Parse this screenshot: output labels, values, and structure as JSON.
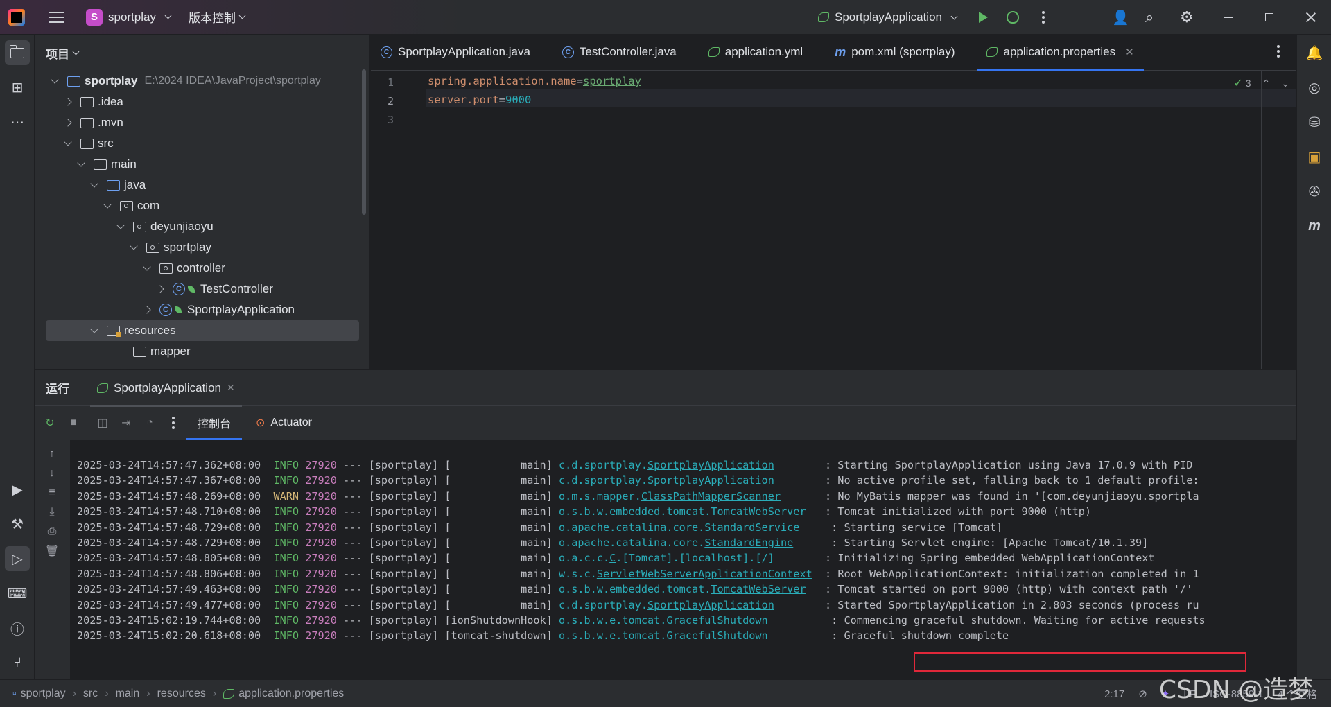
{
  "titlebar": {
    "project_badge": "S",
    "project_name": "sportplay",
    "vcs_label": "版本控制",
    "run_config": "SportplayApplication"
  },
  "project_panel": {
    "title": "项目",
    "tree": [
      {
        "label": "sportplay",
        "path": "E:\\2024 IDEA\\JavaProject\\sportplay",
        "level": 0,
        "arrow": "down",
        "icon": "module"
      },
      {
        "label": ".idea",
        "level": 1,
        "arrow": "right",
        "icon": "folder"
      },
      {
        "label": ".mvn",
        "level": 1,
        "arrow": "right",
        "icon": "folder"
      },
      {
        "label": "src",
        "level": 1,
        "arrow": "down",
        "icon": "folder"
      },
      {
        "label": "main",
        "level": 2,
        "arrow": "down",
        "icon": "folder"
      },
      {
        "label": "java",
        "level": 3,
        "arrow": "down",
        "icon": "source-folder"
      },
      {
        "label": "com",
        "level": 4,
        "arrow": "down",
        "icon": "package"
      },
      {
        "label": "deyunjiaoyu",
        "level": 5,
        "arrow": "down",
        "icon": "package"
      },
      {
        "label": "sportplay",
        "level": 6,
        "arrow": "down",
        "icon": "package"
      },
      {
        "label": "controller",
        "level": 7,
        "arrow": "down",
        "icon": "package"
      },
      {
        "label": "TestController",
        "level": 8,
        "arrow": "right",
        "icon": "class"
      },
      {
        "label": "SportplayApplication",
        "level": 7,
        "arrow": "right",
        "icon": "spring-class"
      },
      {
        "label": "resources",
        "level": 3,
        "arrow": "down",
        "icon": "resources",
        "selected": true
      },
      {
        "label": "mapper",
        "level": 5,
        "arrow": "none",
        "icon": "folder"
      }
    ]
  },
  "editor": {
    "tabs": [
      {
        "label": "SportplayApplication.java",
        "icon": "spring-class"
      },
      {
        "label": "TestController.java",
        "icon": "class"
      },
      {
        "label": "application.yml",
        "icon": "spring"
      },
      {
        "label": "pom.xml (sportplay)",
        "icon": "maven"
      },
      {
        "label": "application.properties",
        "icon": "spring",
        "active": true
      }
    ],
    "lines": [
      {
        "num": "1",
        "key": "spring.application.name",
        "eq": "=",
        "value": "sportplay"
      },
      {
        "num": "2",
        "key": "server.port",
        "eq": "=",
        "value": "9000"
      },
      {
        "num": "3",
        "key": "",
        "eq": "",
        "value": ""
      }
    ],
    "inspection_count": "3"
  },
  "run_panel": {
    "title": "运行",
    "tab_label": "SportplayApplication",
    "console_tab": "控制台",
    "actuator_tab": "Actuator",
    "log": [
      {
        "ts": "2025-03-24T14:57:47.362+08:00",
        "level": "INFO",
        "pid": "27920",
        "mid": " --- [sportplay] [           main] ",
        "logger_prefix": "c.d.sportplay.",
        "logger_class": "SportplayApplication",
        "pad": "       ",
        "msg": ": Starting SportplayApplication using Java 17.0.9 with PID"
      },
      {
        "ts": "2025-03-24T14:57:47.367+08:00",
        "level": "INFO",
        "pid": "27920",
        "mid": " --- [sportplay] [           main] ",
        "logger_prefix": "c.d.sportplay.",
        "logger_class": "SportplayApplication",
        "pad": "       ",
        "msg": ": No active profile set, falling back to 1 default profile:"
      },
      {
        "ts": "2025-03-24T14:57:48.269+08:00",
        "level": "WARN",
        "pid": "27920",
        "mid": " --- [sportplay] [           main] ",
        "logger_prefix": "o.m.s.mapper.",
        "logger_class": "ClassPathMapperScanner",
        "pad": "      ",
        "msg": ": No MyBatis mapper was found in '[com.deyunjiaoyu.sportpla"
      },
      {
        "ts": "2025-03-24T14:57:48.710+08:00",
        "level": "INFO",
        "pid": "27920",
        "mid": " --- [sportplay] [           main] ",
        "logger_prefix": "o.s.b.w.embedded.tomcat.",
        "logger_class": "TomcatWebServer",
        "pad": "  ",
        "msg": ": Tomcat initialized with port 9000 (http)"
      },
      {
        "ts": "2025-03-24T14:57:48.729+08:00",
        "level": "INFO",
        "pid": "27920",
        "mid": " --- [sportplay] [           main] ",
        "logger_prefix": "o.apache.catalina.core.",
        "logger_class": "StandardService",
        "pad": "    ",
        "msg": ": Starting service [Tomcat]"
      },
      {
        "ts": "2025-03-24T14:57:48.729+08:00",
        "level": "INFO",
        "pid": "27920",
        "mid": " --- [sportplay] [           main] ",
        "logger_prefix": "o.apache.catalina.core.",
        "logger_class": "StandardEngine",
        "pad": "     ",
        "msg": ": Starting Servlet engine: [Apache Tomcat/10.1.39]"
      },
      {
        "ts": "2025-03-24T14:57:48.805+08:00",
        "level": "INFO",
        "pid": "27920",
        "mid": " --- [sportplay] [           main] ",
        "logger_prefix": "o.a.c.c.",
        "logger_class": "C",
        "logger_suffix": ".[Tomcat].[localhost].[/]",
        "pad": "       ",
        "msg": ": Initializing Spring embedded WebApplicationContext"
      },
      {
        "ts": "2025-03-24T14:57:48.806+08:00",
        "level": "INFO",
        "pid": "27920",
        "mid": " --- [sportplay] [           main] ",
        "logger_prefix": "w.s.c.",
        "logger_class": "ServletWebServerApplicationContext",
        "pad": " ",
        "msg": ": Root WebApplicationContext: initialization completed in 1"
      },
      {
        "ts": "2025-03-24T14:57:49.463+08:00",
        "level": "INFO",
        "pid": "27920",
        "mid": " --- [sportplay] [           main] ",
        "logger_prefix": "o.s.b.w.embedded.tomcat.",
        "logger_class": "TomcatWebServer",
        "pad": "  ",
        "msg": ": Tomcat started on port 9000 (http) with context path '/'"
      },
      {
        "ts": "2025-03-24T14:57:49.477+08:00",
        "level": "INFO",
        "pid": "27920",
        "mid": " --- [sportplay] [           main] ",
        "logger_prefix": "c.d.sportplay.",
        "logger_class": "SportplayApplication",
        "pad": "       ",
        "msg": ": Started SportplayApplication in 2.803 seconds (process ru"
      },
      {
        "ts": "2025-03-24T15:02:19.744+08:00",
        "level": "INFO",
        "pid": "27920",
        "mid": " --- [sportplay] [ionShutdownHook] ",
        "logger_prefix": "o.s.b.w.e.tomcat.",
        "logger_class": "GracefulShutdown",
        "pad": "         ",
        "msg": ": Commencing graceful shutdown. Waiting for active requests"
      },
      {
        "ts": "2025-03-24T15:02:20.618+08:00",
        "level": "INFO",
        "pid": "27920",
        "mid": " --- [sportplay] [tomcat-shutdown] ",
        "logger_prefix": "o.s.b.w.e.tomcat.",
        "logger_class": "GracefulShutdown",
        "pad": "         ",
        "msg": ": Graceful shutdown complete"
      }
    ]
  },
  "statusbar": {
    "breadcrumb": [
      "sportplay",
      "src",
      "main",
      "resources",
      "application.properties"
    ],
    "caret": "2:17",
    "line_sep": "LF",
    "encoding": "ISO-8859-1",
    "indent": "4 个空格"
  },
  "watermark": "CSDN @造梦"
}
